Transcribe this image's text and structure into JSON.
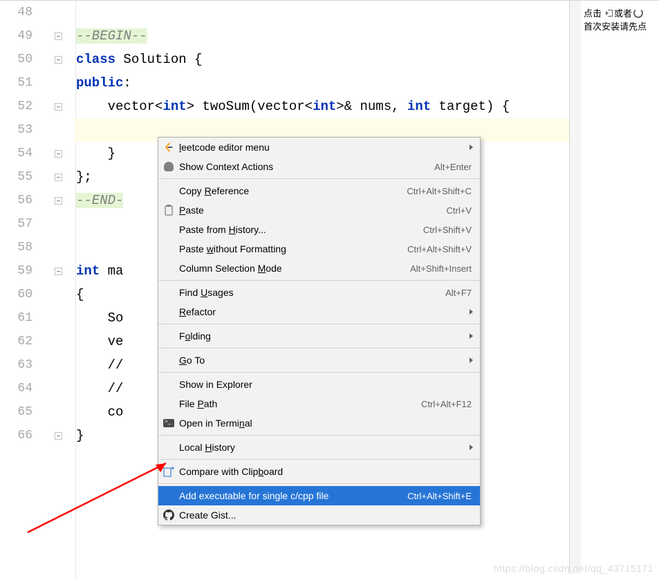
{
  "gutter": {
    "start": 48,
    "end": 66
  },
  "code": {
    "lines": [
      {
        "n": 48,
        "segs": [
          {
            "t": "",
            "c": "plain"
          }
        ]
      },
      {
        "n": 49,
        "segs": [
          {
            "t": "--BEGIN--",
            "c": "comment-begin"
          }
        ],
        "fold": true
      },
      {
        "n": 50,
        "segs": [
          {
            "t": "class",
            "c": "kw"
          },
          {
            "t": " Solution {",
            "c": "plain"
          }
        ],
        "fold": true
      },
      {
        "n": 51,
        "segs": [
          {
            "t": "public",
            "c": "kw"
          },
          {
            "t": ":",
            "c": "plain"
          }
        ]
      },
      {
        "n": 52,
        "segs": [
          {
            "t": "    vector<",
            "c": "plain"
          },
          {
            "t": "int",
            "c": "kw"
          },
          {
            "t": "> twoSum(vector<",
            "c": "plain"
          },
          {
            "t": "int",
            "c": "kw"
          },
          {
            "t": ">& nums, ",
            "c": "plain"
          },
          {
            "t": "int",
            "c": "kw"
          },
          {
            "t": " target) {",
            "c": "plain"
          }
        ],
        "fold": true
      },
      {
        "n": 53,
        "segs": [
          {
            "t": "",
            "c": "plain"
          }
        ],
        "cursor": true
      },
      {
        "n": 54,
        "segs": [
          {
            "t": "    }",
            "c": "plain"
          }
        ],
        "fold": true
      },
      {
        "n": 55,
        "segs": [
          {
            "t": "};",
            "c": "plain"
          }
        ],
        "fold": true
      },
      {
        "n": 56,
        "segs": [
          {
            "t": "--END-",
            "c": "comment-end"
          }
        ],
        "fold": true
      },
      {
        "n": 57,
        "segs": [
          {
            "t": "",
            "c": "plain"
          }
        ]
      },
      {
        "n": 58,
        "segs": [
          {
            "t": "",
            "c": "plain"
          }
        ]
      },
      {
        "n": 59,
        "segs": [
          {
            "t": "int",
            "c": "kw"
          },
          {
            "t": " ma",
            "c": "plain"
          }
        ],
        "fold": true
      },
      {
        "n": 60,
        "segs": [
          {
            "t": "{",
            "c": "plain"
          }
        ]
      },
      {
        "n": 61,
        "segs": [
          {
            "t": "    So",
            "c": "plain"
          }
        ]
      },
      {
        "n": 62,
        "segs": [
          {
            "t": "    ve",
            "c": "plain"
          }
        ]
      },
      {
        "n": 63,
        "segs": [
          {
            "t": "    //",
            "c": "plain"
          }
        ]
      },
      {
        "n": 64,
        "segs": [
          {
            "t": "    //",
            "c": "plain"
          }
        ]
      },
      {
        "n": 65,
        "segs": [
          {
            "t": "    co",
            "c": "plain"
          }
        ]
      },
      {
        "n": 66,
        "segs": [
          {
            "t": "}",
            "c": "plain"
          }
        ],
        "fold": true
      }
    ]
  },
  "context_menu": {
    "items": [
      {
        "label_pre": "",
        "u": "l",
        "label_post": "eetcode editor menu",
        "icon": "leetcode",
        "submenu": true
      },
      {
        "label_pre": "Show Context Actions",
        "u": "",
        "label_post": "",
        "icon": "bulb",
        "shortcut": "Alt+Enter"
      },
      {
        "separator": true
      },
      {
        "label_pre": "Copy ",
        "u": "R",
        "label_post": "eference",
        "shortcut": "Ctrl+Alt+Shift+C"
      },
      {
        "label_pre": "",
        "u": "P",
        "label_post": "aste",
        "icon": "clipboard",
        "shortcut": "Ctrl+V"
      },
      {
        "label_pre": "Paste from ",
        "u": "H",
        "label_post": "istory...",
        "shortcut": "Ctrl+Shift+V"
      },
      {
        "label_pre": "Paste ",
        "u": "w",
        "label_post": "ithout Formatting",
        "shortcut": "Ctrl+Alt+Shift+V"
      },
      {
        "label_pre": "Column Selection ",
        "u": "M",
        "label_post": "ode",
        "shortcut": "Alt+Shift+Insert"
      },
      {
        "separator": true
      },
      {
        "label_pre": "Find ",
        "u": "U",
        "label_post": "sages",
        "shortcut": "Alt+F7"
      },
      {
        "label_pre": "",
        "u": "R",
        "label_post": "efactor",
        "submenu": true
      },
      {
        "separator": true
      },
      {
        "label_pre": "F",
        "u": "o",
        "label_post": "lding",
        "submenu": true
      },
      {
        "separator": true
      },
      {
        "label_pre": "",
        "u": "G",
        "label_post": "o To",
        "submenu": true
      },
      {
        "separator": true
      },
      {
        "label_pre": "Show in Explorer",
        "u": "",
        "label_post": ""
      },
      {
        "label_pre": "File ",
        "u": "P",
        "label_post": "ath",
        "shortcut": "Ctrl+Alt+F12"
      },
      {
        "label_pre": "Open in Termi",
        "u": "n",
        "label_post": "al",
        "icon": "terminal"
      },
      {
        "separator": true
      },
      {
        "label_pre": "Local ",
        "u": "H",
        "label_post": "istory",
        "submenu": true
      },
      {
        "separator": true
      },
      {
        "label_pre": "Compare with Clip",
        "u": "b",
        "label_post": "oard",
        "icon": "compare"
      },
      {
        "separator": true
      },
      {
        "label_pre": "Add executable for single c/cpp file",
        "u": "",
        "label_post": "",
        "shortcut": "Ctrl+Alt+Shift+E",
        "selected": true
      },
      {
        "label_pre": "Create Gist...",
        "u": "",
        "label_post": "",
        "icon": "github"
      }
    ]
  },
  "right_panel": {
    "line1_a": "点击",
    "line1_b": "或者",
    "line2": "首次安装请先点"
  },
  "watermark": "https://blog.csdn.net/qq_43715171"
}
